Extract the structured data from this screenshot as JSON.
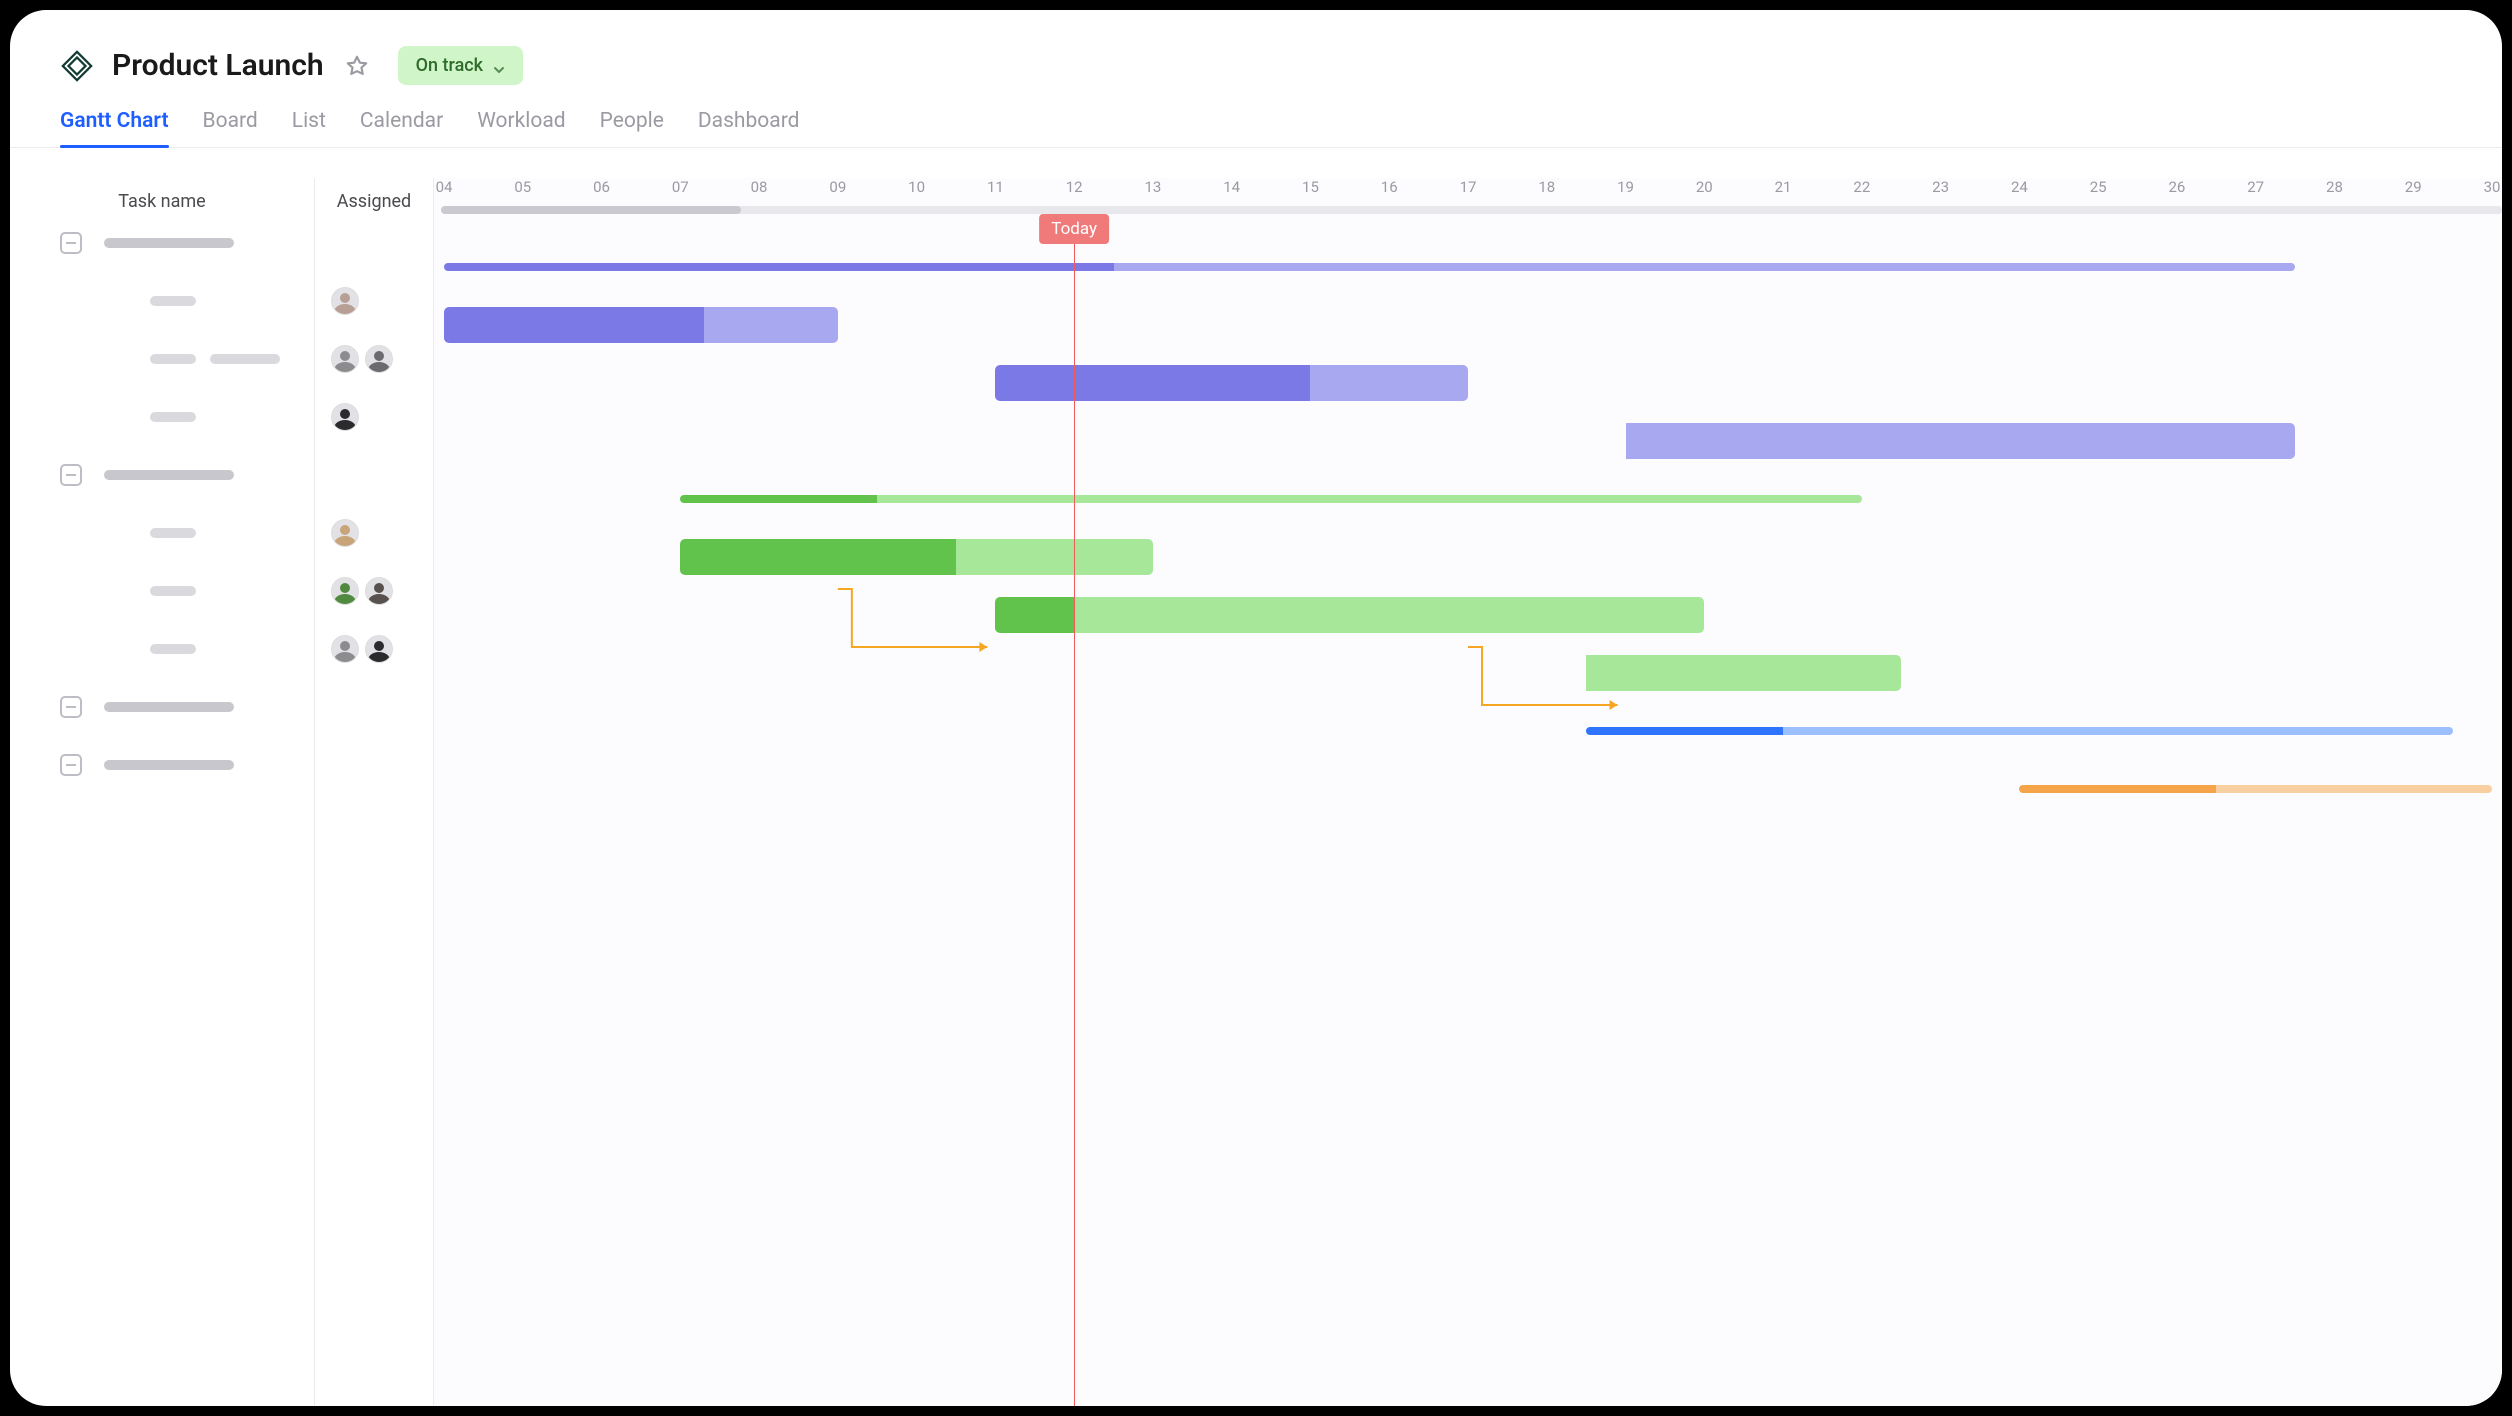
{
  "header": {
    "title": "Product Launch",
    "status_label": "On track"
  },
  "tabs": [
    {
      "id": "gantt",
      "label": "Gantt Chart",
      "active": true
    },
    {
      "id": "board",
      "label": "Board"
    },
    {
      "id": "list",
      "label": "List"
    },
    {
      "id": "calendar",
      "label": "Calendar"
    },
    {
      "id": "workload",
      "label": "Workload"
    },
    {
      "id": "people",
      "label": "People"
    },
    {
      "id": "dashboard",
      "label": "Dashboard"
    }
  ],
  "columns": {
    "task_header": "Task name",
    "assigned_header": "Assigned"
  },
  "timeline": {
    "start_day": 4,
    "end_day": 30,
    "today_day": 12,
    "today_label": "Today",
    "days": [
      4,
      5,
      6,
      7,
      8,
      9,
      10,
      11,
      12,
      13,
      14,
      15,
      16,
      17,
      18,
      19,
      20,
      21,
      22,
      23,
      24,
      25,
      26,
      27,
      28,
      29,
      30
    ]
  },
  "colors": {
    "purple_dark": "#7a79e6",
    "purple_light": "#a7a8ef",
    "green_dark": "#62c34c",
    "green_light": "#a6e79a",
    "blue_dark": "#2f74ff",
    "blue_light": "#9cc0ff",
    "orange_dark": "#f5a44a",
    "orange_light": "#f7cfa1"
  },
  "rows": [
    {
      "type": "group",
      "id": "g1"
    },
    {
      "type": "task",
      "id": "t1",
      "assignees": [
        "a1"
      ]
    },
    {
      "type": "task",
      "id": "t2",
      "assignees": [
        "a2",
        "a3"
      ]
    },
    {
      "type": "task",
      "id": "t3",
      "assignees": [
        "a4"
      ]
    },
    {
      "type": "group",
      "id": "g2"
    },
    {
      "type": "task",
      "id": "t4",
      "assignees": [
        "a5"
      ]
    },
    {
      "type": "task",
      "id": "t5",
      "assignees": [
        "a6",
        "a7"
      ]
    },
    {
      "type": "task",
      "id": "t6",
      "assignees": [
        "a2",
        "a8"
      ]
    },
    {
      "type": "group",
      "id": "g3"
    },
    {
      "type": "group",
      "id": "g4"
    }
  ],
  "chart_data": {
    "type": "gantt",
    "x_unit": "day-of-month",
    "x_range": [
      4,
      30
    ],
    "today": 12,
    "groups": [
      {
        "id": "g1",
        "row": 0,
        "start": 4,
        "end": 27.5,
        "progress_end": 12.5,
        "color": "purple"
      },
      {
        "id": "g2",
        "row": 4,
        "start": 7,
        "end": 22,
        "progress_end": 9.5,
        "color": "green"
      },
      {
        "id": "g3",
        "row": 8,
        "start": 18.5,
        "end": 29.5,
        "progress_end": 21,
        "color": "blue"
      },
      {
        "id": "g4",
        "row": 9,
        "start": 24,
        "end": 30,
        "progress_end": 26.5,
        "color": "orange"
      }
    ],
    "tasks": [
      {
        "id": "t1",
        "row": 1,
        "start": 4,
        "end": 9,
        "progress_end": 7.3,
        "color": "purple"
      },
      {
        "id": "t2",
        "row": 2,
        "start": 11,
        "end": 17,
        "progress_end": 15,
        "color": "purple"
      },
      {
        "id": "t3",
        "row": 3,
        "start": 19,
        "end": 27.5,
        "progress_end": 19,
        "color": "purple_light_only"
      },
      {
        "id": "t4",
        "row": 5,
        "start": 7,
        "end": 13,
        "progress_end": 10.5,
        "color": "green"
      },
      {
        "id": "t5",
        "row": 6,
        "start": 11,
        "end": 20,
        "progress_end": 12,
        "color": "green"
      },
      {
        "id": "t6",
        "row": 7,
        "start": 18.5,
        "end": 22.5,
        "progress_end": 18.5,
        "color": "green_light_only"
      }
    ],
    "dependencies": [
      {
        "from": "t1",
        "to": "t2"
      },
      {
        "from": "t2",
        "to": "t3"
      }
    ]
  }
}
